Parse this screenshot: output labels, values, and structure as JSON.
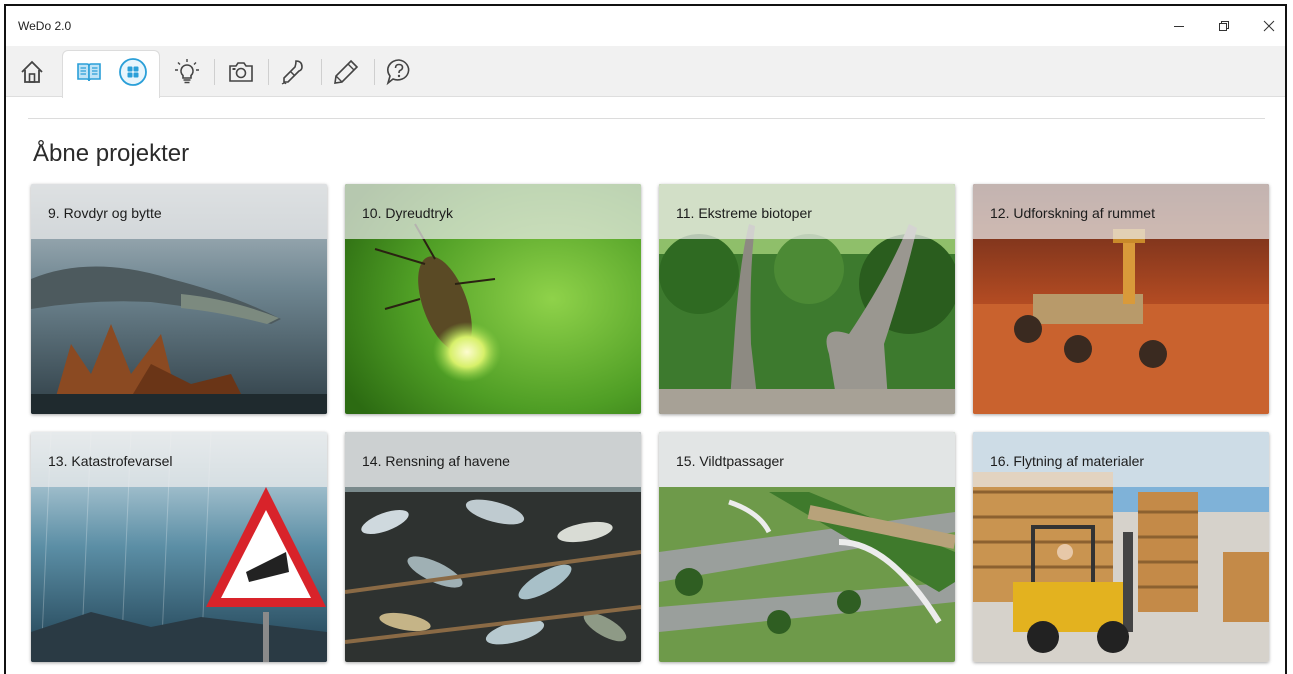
{
  "window": {
    "title": "WeDo 2.0",
    "controls": {
      "minimize": "minimize",
      "restore": "restore",
      "close": "close"
    }
  },
  "toolbar": {
    "tools": [
      {
        "name": "home-icon"
      },
      {
        "name": "book-icon",
        "active": true
      },
      {
        "name": "grid-icon"
      },
      {
        "name": "lightbulb-icon"
      },
      {
        "name": "camera-icon"
      },
      {
        "name": "dropper-icon"
      },
      {
        "name": "pencil-icon"
      },
      {
        "name": "help-icon"
      }
    ]
  },
  "main": {
    "heading": "Åbne projekter",
    "projects": [
      {
        "label": "9. Rovdyr og bytte"
      },
      {
        "label": "10. Dyreudtryk"
      },
      {
        "label": "11. Ekstreme biotoper"
      },
      {
        "label": "12. Udforskning af rummet"
      },
      {
        "label": "13. Katastrofevarsel"
      },
      {
        "label": "14. Rensning af havene"
      },
      {
        "label": "15. Vildtpassager"
      },
      {
        "label": "16. Flytning af materialer"
      }
    ]
  },
  "colors": {
    "accent": "#2a9fd8",
    "toolbar_bg": "#f1f1f1"
  }
}
